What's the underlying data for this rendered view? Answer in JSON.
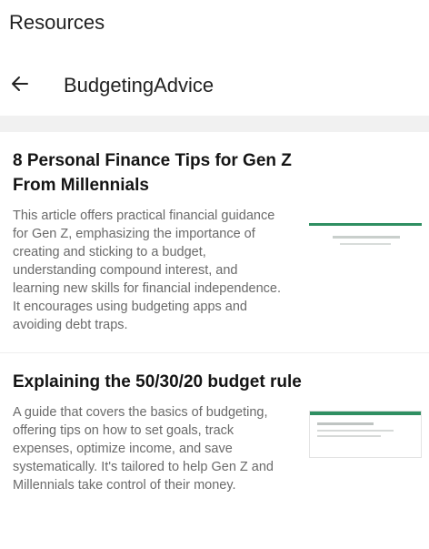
{
  "app": {
    "title": "Resources"
  },
  "subheader": {
    "title": "BudgetingAdvice",
    "back_icon": "arrow-left-icon"
  },
  "articles": [
    {
      "title": "8 Personal Finance Tips for Gen Z From Millennials",
      "description": "This article offers practical financial guidance for Gen Z, emphasizing the importance of creating and sticking to a budget, understanding compound interest, and learning new skills for financial independence. It encourages using budgeting apps and avoiding debt traps."
    },
    {
      "title": "Explaining the 50/30/20 budget rule",
      "description": "A guide that covers the basics of budgeting, offering tips on how to set goals, track expenses, optimize income, and save systematically. It's tailored to help Gen Z and Millennials take control of their money."
    }
  ],
  "colors": {
    "accent": "#2f8f62",
    "text_primary": "#141414",
    "text_secondary": "#6a6a6a"
  }
}
